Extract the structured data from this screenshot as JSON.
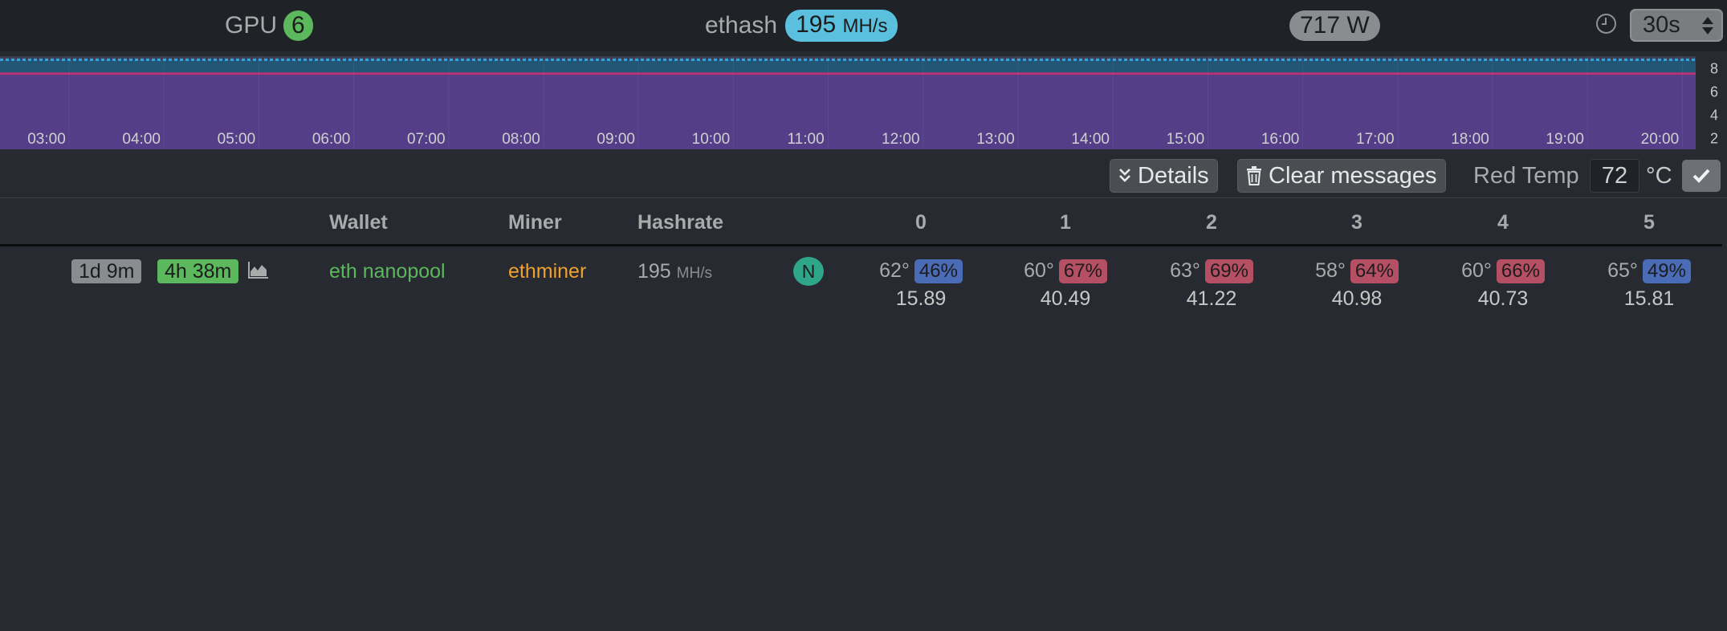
{
  "header": {
    "gpu_label": "GPU",
    "gpu_count": "6",
    "algo": "ethash",
    "hashrate_value": "195",
    "hashrate_unit": "MH/s",
    "power": "717 W",
    "interval": "30s"
  },
  "chart_data": {
    "type": "area",
    "x_ticks": [
      "03:00",
      "04:00",
      "05:00",
      "06:00",
      "07:00",
      "08:00",
      "09:00",
      "10:00",
      "11:00",
      "12:00",
      "13:00",
      "14:00",
      "15:00",
      "16:00",
      "17:00",
      "18:00",
      "19:00",
      "20:00"
    ],
    "y_ticks": [
      "2",
      "4",
      "6",
      "8"
    ],
    "ylim": [
      1,
      9
    ],
    "grid": true,
    "series": [
      {
        "color": "#5d3a8c",
        "values": [
          7.5,
          7.5,
          7.5,
          7.5,
          7.5,
          7.5,
          7.5,
          7.5,
          7.5,
          7.5,
          7.5,
          7.5,
          7.5,
          7.5,
          7.5,
          7.5,
          7.5,
          7.5
        ]
      },
      {
        "color": "#1e5a7a",
        "values": [
          8.7,
          8.7,
          8.7,
          8.7,
          8.7,
          8.7,
          8.7,
          8.7,
          8.7,
          8.7,
          8.7,
          8.7,
          8.7,
          8.7,
          8.7,
          8.7,
          8.7,
          8.7
        ]
      }
    ]
  },
  "toolbar": {
    "details_label": "Details",
    "clear_label": "Clear messages",
    "red_temp_label": "Red Temp",
    "red_temp_value": "72",
    "temp_unit": "°C"
  },
  "table": {
    "headers": {
      "wallet": "Wallet",
      "miner": "Miner",
      "hashrate": "Hashrate",
      "gpus": [
        "0",
        "1",
        "2",
        "3",
        "4",
        "5"
      ]
    },
    "row": {
      "uptime": "1d 9m",
      "runtime": "4h 38m",
      "wallet": "eth nanopool",
      "miner": "ethminer",
      "hashrate_value": "195",
      "hashrate_unit": "MH/s",
      "vendor": "N",
      "gpus": [
        {
          "temp": "62°",
          "fan": "46%",
          "rate": "15.89",
          "fan_color": "#4a6bb5"
        },
        {
          "temp": "60°",
          "fan": "67%",
          "rate": "40.49",
          "fan_color": "#b54f64"
        },
        {
          "temp": "63°",
          "fan": "69%",
          "rate": "41.22",
          "fan_color": "#b54f64"
        },
        {
          "temp": "58°",
          "fan": "64%",
          "rate": "40.98",
          "fan_color": "#b54f64"
        },
        {
          "temp": "60°",
          "fan": "66%",
          "rate": "40.73",
          "fan_color": "#b54f64"
        },
        {
          "temp": "65°",
          "fan": "49%",
          "rate": "15.81",
          "fan_color": "#4a6bb5"
        }
      ]
    }
  }
}
